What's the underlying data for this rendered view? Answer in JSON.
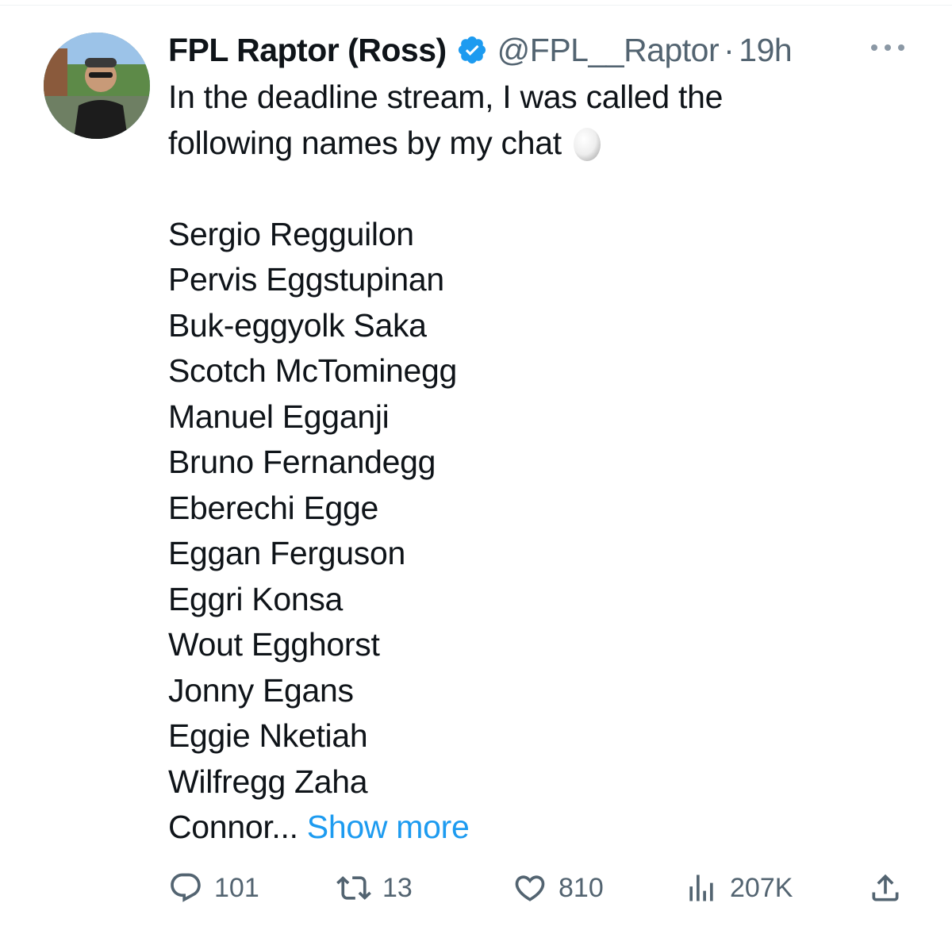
{
  "tweet": {
    "author": {
      "display_name": "FPL Raptor (Ross)",
      "handle": "@FPL__Raptor",
      "separator": "·",
      "time": "19h",
      "verified_color": "#1d9bf0"
    },
    "text_lines": [
      "In the deadline stream, I was called the",
      "following names by my chat"
    ],
    "egg_emoji": "🥚",
    "names": [
      "Sergio Regguilon",
      "Pervis Eggstupinan",
      "Buk-eggyolk Saka",
      "Scotch McTominegg",
      "Manuel Egganji",
      "Bruno Fernandegg",
      "Eberechi Egge",
      "Eggan Ferguson",
      "Eggri Konsa",
      "Wout Egghorst",
      "Jonny Egans",
      "Eggie Nketiah",
      "Wilfregg Zaha"
    ],
    "truncated_text": "Connor...",
    "show_more_label": "Show more",
    "show_more_color": "#1d9bf0",
    "stats": {
      "replies": "101",
      "retweets": "13",
      "likes": "810",
      "views": "207K"
    },
    "icons": {
      "reply": "reply-icon",
      "retweet": "retweet-icon",
      "like": "heart-icon",
      "views": "views-chart-icon",
      "share": "share-icon",
      "more": "more-dots-icon",
      "verified": "verified-badge-icon"
    }
  }
}
